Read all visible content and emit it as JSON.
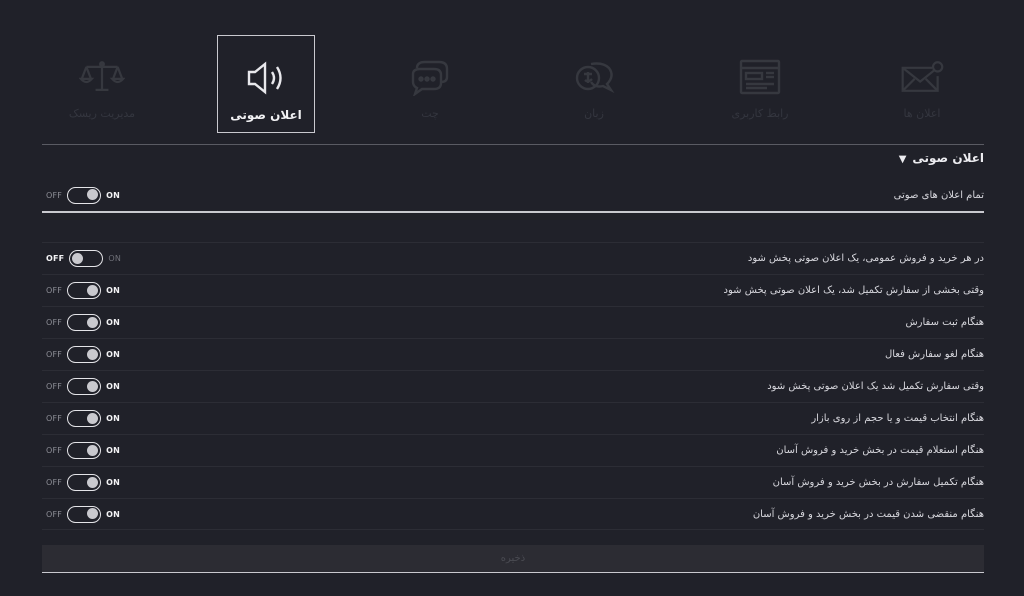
{
  "tabs": [
    {
      "label": "مدیریت ریسک",
      "icon": "scale-icon",
      "active": false
    },
    {
      "label": "اعلان صوتی",
      "icon": "speaker-icon",
      "active": true
    },
    {
      "label": "چت",
      "icon": "chat-icon",
      "active": false
    },
    {
      "label": "زبان",
      "icon": "language-icon",
      "active": false
    },
    {
      "label": "رابط کاربری",
      "icon": "layout-icon",
      "active": false
    },
    {
      "label": "اعلان ها",
      "icon": "mail-notification-icon",
      "active": false
    }
  ],
  "section": {
    "title": "اعلان صوتی",
    "master": {
      "label": "تمام اعلان های صوتی",
      "on": true
    }
  },
  "switch_labels": {
    "off": "OFF",
    "on": "ON"
  },
  "settings": [
    {
      "label": "در هر خرید و فروش عمومی، یک اعلان صوتی پخش شود",
      "on": false
    },
    {
      "label": "وقتی بخشی از سفارش تکمیل شد، یک اعلان صوتی پخش شود",
      "on": true
    },
    {
      "label": "هنگام ثبت سفارش",
      "on": true
    },
    {
      "label": "هنگام لغو سفارش فعال",
      "on": true
    },
    {
      "label": "وقتی سفارش تکمیل شد یک اعلان صوتی پخش شود",
      "on": true
    },
    {
      "label": "هنگام انتخاب قیمت و یا حجم از روی بازار",
      "on": true
    },
    {
      "label": "هنگام استعلام قیمت در بخش خرید و فروش آسان",
      "on": true
    },
    {
      "label": "هنگام تکمیل سفارش در بخش خرید و فروش آسان",
      "on": true
    },
    {
      "label": "هنگام منقضی شدن قیمت در بخش خرید و فروش آسان",
      "on": true
    }
  ],
  "save_label": "ذخیره",
  "colors": {
    "background": "#202129",
    "text": "#e6e6ea",
    "muted_icon": "#36383f"
  }
}
